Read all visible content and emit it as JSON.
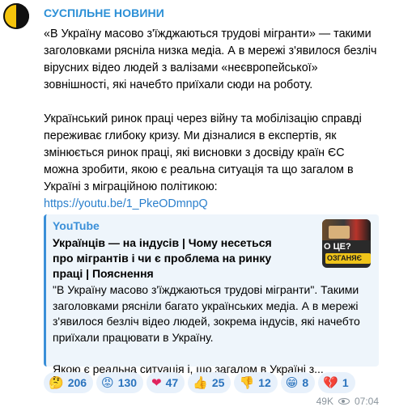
{
  "channel": {
    "name": "СУСПІЛЬНЕ НОВИНИ"
  },
  "message": {
    "paragraph1": "«В Україну масово з'їжджаються трудові мігранти» — такими заголовками рясніла низка медіа. А в мережі з'явилося безліч вірусних відео людей з валізами «неєвропейської» зовнішності, які начебто приїхали сюди на роботу.",
    "paragraph2": "Український ринок праці через війну та мобілізацію справді переживає глибоку кризу. Ми дізналися в експертів, як змінюється ринок праці, які висновки з досвіду країн ЄС можна зробити, якою є реальна ситуація та що загалом в Україні з міграційною політикою:",
    "link": "https://youtu.be/1_PkeODmnpQ"
  },
  "preview": {
    "site": "YouTube",
    "title": "Українців — на індусів | Чому несеться про мігрантів і чи є проблема на ринку праці | Пояснення",
    "desc_line1": "\"В Україну масово з'їжджаються трудові мігранти\". Такими заголовками рясніли багато українських медіа. А в мережі з'явилося безліч відео людей, зокрема індусів, які начебто приїхали працювати в Україну.",
    "desc_line2": "Якою є реальна ситуація і, що загалом в Україні з...",
    "thumb_text1": "О ЦЕ?",
    "thumb_text2": "ОЗГАНЯЄ"
  },
  "reactions": [
    {
      "icon": "thinking-face",
      "emoji": "🤔",
      "count": "206"
    },
    {
      "icon": "angry-face",
      "emoji": "😡",
      "count": "130"
    },
    {
      "icon": "red-heart",
      "emoji": "❤",
      "count": "47"
    },
    {
      "icon": "thumbs-up",
      "emoji": "👍",
      "count": "25"
    },
    {
      "icon": "thumbs-down",
      "emoji": "👎",
      "count": "12"
    },
    {
      "icon": "grinning-face",
      "emoji": "😁",
      "count": "8"
    },
    {
      "icon": "broken-heart",
      "emoji": "💔",
      "count": "1"
    }
  ],
  "meta": {
    "views": "49K",
    "time": "07:04"
  }
}
